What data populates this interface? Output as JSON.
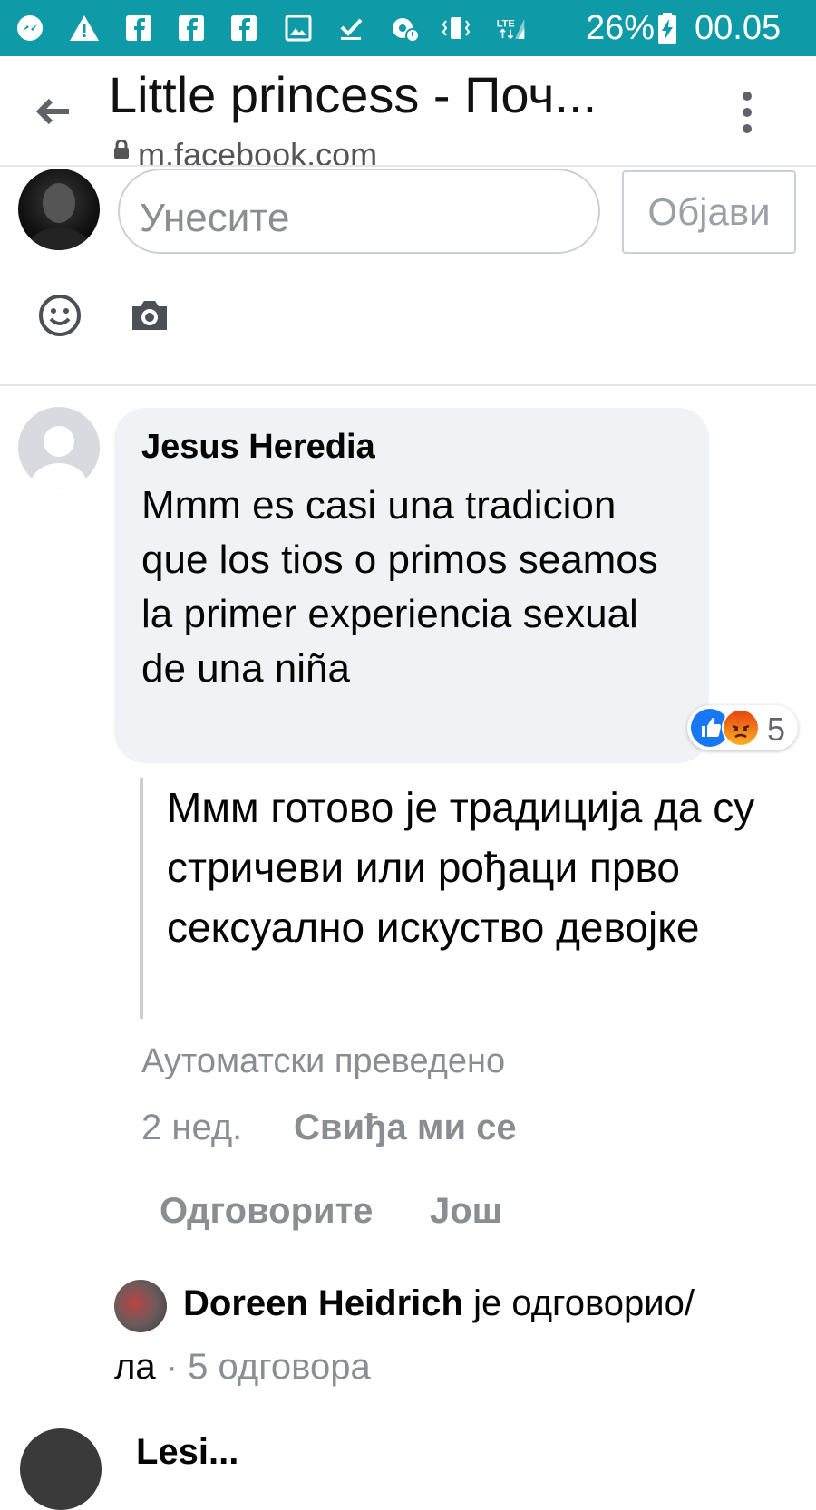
{
  "status_bar": {
    "battery": "26%",
    "time": "00.05",
    "network": "LTE",
    "icons": [
      "messenger-icon",
      "warning-icon",
      "facebook-icon",
      "facebook-icon",
      "facebook-icon",
      "gallery-icon",
      "download-done-icon",
      "settings-alert-icon",
      "vibrate-icon",
      "lte-icon",
      "signal-icon",
      "battery-charging-icon"
    ],
    "bar_color": "#0e9aa7"
  },
  "browser": {
    "title": "Little princess - Поч...",
    "url": "m.facebook.com"
  },
  "composer": {
    "placeholder": "Унесите",
    "post_label": "Објави"
  },
  "comment": {
    "author": "Jesus Heredia",
    "text": "Mmm es casi una tradicion que los tios o primos seamos la primer experiencia sexual de una niña",
    "reactions": {
      "types": [
        "like",
        "angry"
      ],
      "count": "5"
    },
    "translation": "Ммм готово је традиција да су стричеви или рођаци прво сексуално искуство девојке",
    "auto_translated_label": "Аутоматски преведено",
    "time": "2 нед.",
    "like_label": "Свиђа ми се",
    "reply_label": "Одговорите",
    "more_label": "Још",
    "replies": {
      "replier": "Doreen Heidrich",
      "action_part1": " је одговорио/",
      "action_part2": "ла",
      "separator": " · ",
      "count_label": "5 одговора"
    }
  },
  "next_comment": {
    "author": "Lesi..."
  },
  "colors": {
    "link_gray": "#8a8d91",
    "bubble": "#f0f2f5",
    "like_blue": "#1877f2"
  }
}
